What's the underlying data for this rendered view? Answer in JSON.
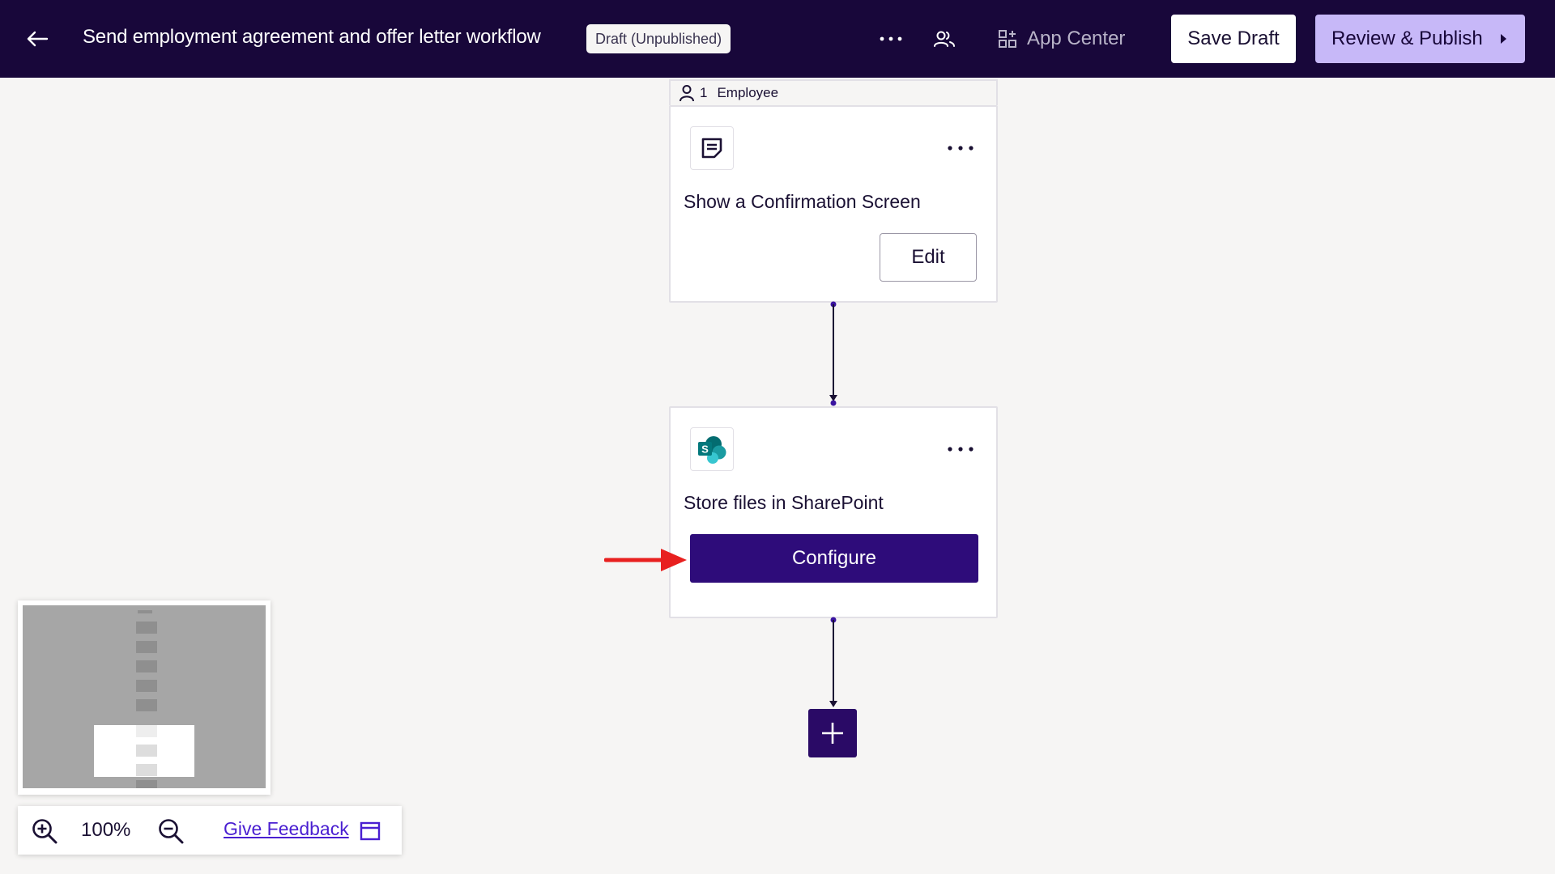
{
  "header": {
    "workflow_title": "Send employment agreement and offer letter workflow",
    "status_badge": "Draft (Unpublished)",
    "app_center_label": "App Center",
    "save_draft_label": "Save Draft",
    "publish_label": "Review & Publish",
    "icons": [
      "back-arrow-icon",
      "more-horizontal-icon",
      "users-icon",
      "app-center-icon",
      "caret-right-icon"
    ]
  },
  "workflow": {
    "step_group": {
      "assignee_count": "1",
      "assignee_label": "Employee"
    },
    "steps": [
      {
        "title": "Show a Confirmation Screen",
        "icon": "form-screen-icon",
        "action_label": "Edit"
      },
      {
        "title": "Store files in SharePoint",
        "icon": "sharepoint-icon",
        "icon_letter": "S",
        "action_label": "Configure"
      }
    ],
    "add_step_icon": "plus-icon"
  },
  "zoom_controls": {
    "zoom_level": "100%",
    "feedback_label": "Give Feedback",
    "icons": [
      "zoom-in-icon",
      "zoom-out-icon",
      "feedback-panel-icon"
    ]
  },
  "colors": {
    "topbar_bg": "#18073a",
    "primary": "#2e0c7a",
    "publish_bg": "#c7b8f8",
    "canvas_bg": "#f6f5f4",
    "annotation_arrow": "#e8201f",
    "link": "#4a1fd1"
  }
}
